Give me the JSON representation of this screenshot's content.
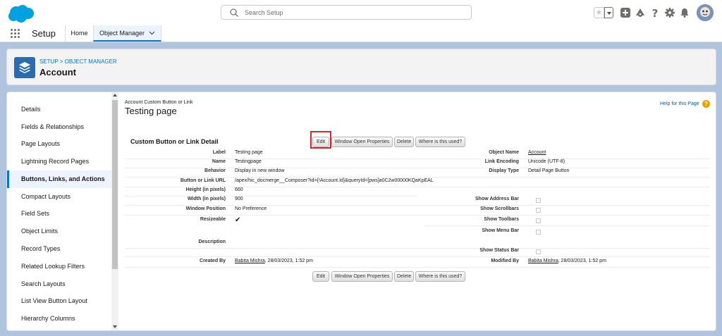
{
  "search": {
    "placeholder": "Search Setup"
  },
  "nav": {
    "app_name": "Setup",
    "tabs": [
      {
        "label": "Home"
      },
      {
        "label": "Object Manager"
      }
    ]
  },
  "header": {
    "breadcrumb_setup": "SETUP",
    "breadcrumb_sep": ">",
    "breadcrumb_object_manager": "OBJECT MANAGER",
    "title": "Account"
  },
  "sidebar": {
    "items": [
      {
        "label": "Details"
      },
      {
        "label": "Fields & Relationships"
      },
      {
        "label": "Page Layouts"
      },
      {
        "label": "Lightning Record Pages"
      },
      {
        "label": "Buttons, Links, and Actions"
      },
      {
        "label": "Compact Layouts"
      },
      {
        "label": "Field Sets"
      },
      {
        "label": "Object Limits"
      },
      {
        "label": "Record Types"
      },
      {
        "label": "Related Lookup Filters"
      },
      {
        "label": "Search Layouts"
      },
      {
        "label": "List View Button Layout"
      },
      {
        "label": "Hierarchy Columns"
      }
    ]
  },
  "page": {
    "crumb": "Account Custom Button or Link",
    "title": "Testing page",
    "help": "Help for this Page",
    "section_title": "Custom Button or Link Detail",
    "buttons": {
      "edit": "Edit",
      "window_open": "Window Open Properties",
      "delete": "Delete",
      "where_used": "Where is this used?"
    },
    "fields": {
      "label": {
        "label": "Label",
        "value": "Testing page"
      },
      "name": {
        "label": "Name",
        "value": "Testingpage"
      },
      "behavior": {
        "label": "Behavior",
        "value": "Display in new window"
      },
      "url": {
        "label": "Button or Link URL",
        "value": "/apex/hic_docmerge__Composer?id={!Account.Id}&queryId=[pws]a0C2w00000KQaKpEAL"
      },
      "height": {
        "label": "Height (in pixels)",
        "value": "660"
      },
      "width": {
        "label": "Width (in pixels)",
        "value": "900"
      },
      "window_position": {
        "label": "Window Position",
        "value": "No Preference"
      },
      "resizeable": {
        "label": "Resizeable",
        "value": "✔"
      },
      "description": {
        "label": "Description",
        "value": ""
      },
      "created_by": {
        "label": "Created By",
        "user": "Babita Mishra",
        "date": ", 28/03/2023, 1:52 pm"
      },
      "object_name": {
        "label": "Object Name",
        "value": "Account"
      },
      "link_encoding": {
        "label": "Link Encoding",
        "value": "Unicode (UTF-8)"
      },
      "display_type": {
        "label": "Display Type",
        "value": "Detail Page Button"
      },
      "show_address_bar": {
        "label": "Show Address Bar"
      },
      "show_scrollbars": {
        "label": "Show Scrollbars"
      },
      "show_toolbars": {
        "label": "Show Toolbars"
      },
      "show_menu_bar": {
        "label": "Show Menu Bar"
      },
      "show_status_bar": {
        "label": "Show Status Bar"
      },
      "modified_by": {
        "label": "Modified By",
        "user": "Babita Mishra",
        "date": ", 28/03/2023, 1:52 pm"
      }
    }
  },
  "colors": {
    "brand": "#0176d3",
    "highlight": "#d6262b",
    "background": "#b0c4df"
  },
  "icons": [
    "salesforce-cloud-logo",
    "search-icon",
    "favorite-star-icon",
    "add-icon",
    "trailhead-icon",
    "help-icon",
    "gear-icon",
    "notification-bell-icon",
    "avatar",
    "app-launcher-icon",
    "chevron-down-icon",
    "object-layers-icon",
    "help-question-icon"
  ]
}
